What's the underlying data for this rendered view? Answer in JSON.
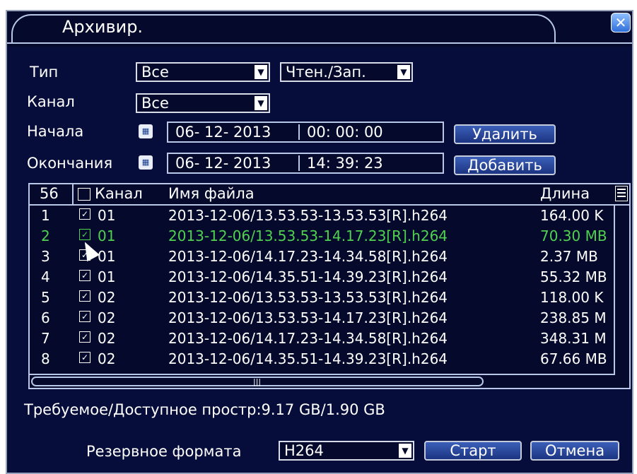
{
  "window": {
    "title": "Архивир.",
    "close_icon": "close-icon"
  },
  "filters": {
    "type_label": "Тип",
    "type_value": "Все",
    "mode_value": "Чтен./Зап.",
    "channel_label": "Канал",
    "channel_value": "Все",
    "start_label": "Начала",
    "start_date": "06- 12- 2013",
    "start_time": "00: 00: 00",
    "end_label": "Окончания",
    "end_date": "06- 12- 2013",
    "end_time": "14: 39: 23",
    "delete_button": "Удалить",
    "add_button": "Добавить"
  },
  "table": {
    "count": "56",
    "col_channel": "Канал",
    "col_filename": "Имя файла",
    "col_length": "Длина",
    "rows": [
      {
        "n": "1",
        "channel": "01",
        "file": "2013-12-06/13.53.53-13.53.53[R].h264",
        "len": "164.00 K",
        "checked": true,
        "selected": false
      },
      {
        "n": "2",
        "channel": "01",
        "file": "2013-12-06/13.53.53-14.17.23[R].h264",
        "len": "70.30 MB",
        "checked": true,
        "selected": true
      },
      {
        "n": "3",
        "channel": "01",
        "file": "2013-12-06/14.17.23-14.34.58[R].h264",
        "len": "2.37 MB",
        "checked": true,
        "selected": false
      },
      {
        "n": "4",
        "channel": "01",
        "file": "2013-12-06/14.35.51-14.39.23[R].h264",
        "len": "55.32 MB",
        "checked": true,
        "selected": false
      },
      {
        "n": "5",
        "channel": "02",
        "file": "2013-12-06/13.53.53-13.53.53[R].h264",
        "len": "118.00 K",
        "checked": true,
        "selected": false
      },
      {
        "n": "6",
        "channel": "02",
        "file": "2013-12-06/13.53.53-14.17.23[R].h264",
        "len": "238.85 M",
        "checked": true,
        "selected": false
      },
      {
        "n": "7",
        "channel": "02",
        "file": "2013-12-06/14.17.23-14.34.58[R].h264",
        "len": "348.31 M",
        "checked": true,
        "selected": false
      },
      {
        "n": "8",
        "channel": "02",
        "file": "2013-12-06/14.35.51-14.39.23[R].h264",
        "len": "67.66 MB",
        "checked": true,
        "selected": false
      }
    ]
  },
  "storage_info": "Требуемое/Доступное простр:9.17 GB/1.90 GB",
  "footer": {
    "format_label": "Резервное формата",
    "format_value": "H264",
    "start_button": "Старт",
    "cancel_button": "Отмена"
  },
  "colors": {
    "background": "#070d3a",
    "selected_row": "#4fd24f",
    "border": "#b9c7e8"
  }
}
